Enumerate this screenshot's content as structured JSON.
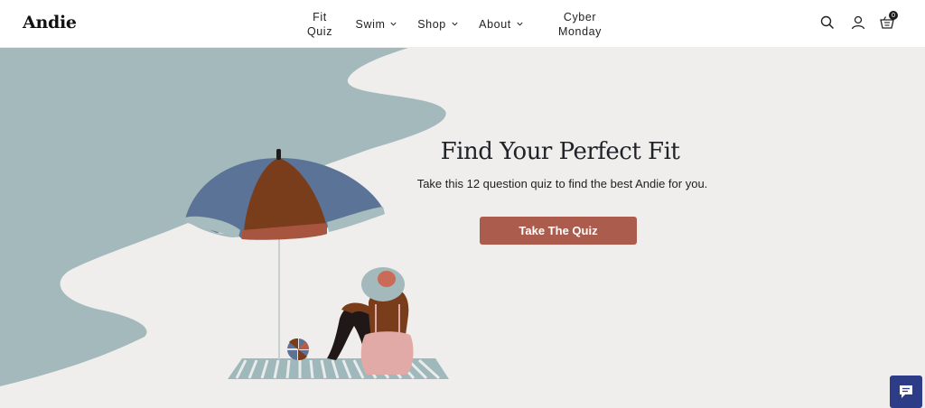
{
  "brand": {
    "logo_text": "Andie"
  },
  "nav": {
    "fit_quiz": {
      "line1": "Fit",
      "line2": "Quiz"
    },
    "swim": "Swim",
    "shop": "Shop",
    "about": "About",
    "cyber_monday": {
      "line1": "Cyber",
      "line2": "Monday"
    }
  },
  "header_icons": [
    "search-icon",
    "account-icon",
    "cart-icon"
  ],
  "cart": {
    "count": "0"
  },
  "hero": {
    "title": "Find Your Perfect Fit",
    "subtitle": "Take this 12 question quiz to find the best Andie for you.",
    "cta_label": "Take The Quiz"
  },
  "colors": {
    "background": "#f0eeec",
    "water": "#a3b9bc",
    "cta": "#ac5c4c",
    "umbrella_blue": "#5a7396",
    "umbrella_brown": "#7a3d1b",
    "chat": "#2c3c86"
  },
  "chat": {
    "icon": "chat-bubble-icon"
  }
}
